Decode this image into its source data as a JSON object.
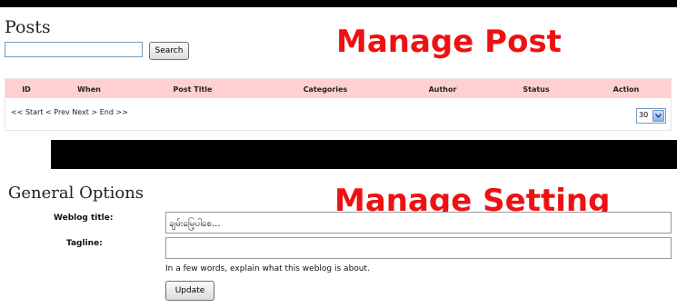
{
  "posts": {
    "title": "Posts",
    "search_placeholder": "",
    "search_label": "Search",
    "banner": "Manage Post",
    "columns": [
      "ID",
      "When",
      "Post Title",
      "Categories",
      "Author",
      "Status",
      "Action"
    ],
    "pager": "<< Start < Prev Next > End >>",
    "per_page": "30"
  },
  "settings": {
    "title": "General Options",
    "banner": "Manage Setting",
    "weblog_title_label": "Weblog title:",
    "weblog_title_value": "ချမ်းမြေ့ပါစေ...",
    "tagline_label": "Tagline:",
    "tagline_value": "",
    "help_text": "In a few words, explain what this weblog is about.",
    "update_label": "Update"
  },
  "colors": {
    "banner": "#ee1111",
    "table_header_bg": "#ffd0d0"
  }
}
